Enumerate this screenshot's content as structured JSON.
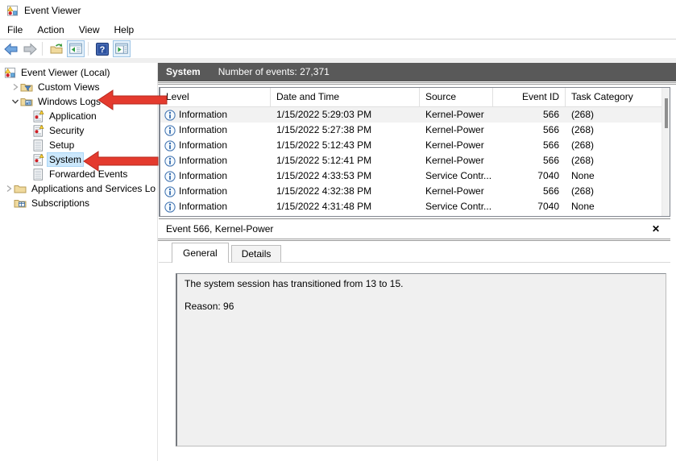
{
  "window": {
    "title": "Event Viewer"
  },
  "menu": {
    "items": [
      "File",
      "Action",
      "View",
      "Help"
    ]
  },
  "toolbar": {
    "buttons": [
      "back",
      "forward",
      "open-saved-log",
      "show-console-tree",
      "help",
      "show-action-pane"
    ]
  },
  "sidebar": {
    "items": [
      {
        "label": "Event Viewer (Local)"
      },
      {
        "label": "Custom Views"
      },
      {
        "label": "Windows Logs"
      },
      {
        "label": "Application"
      },
      {
        "label": "Security"
      },
      {
        "label": "Setup"
      },
      {
        "label": "System"
      },
      {
        "label": "Forwarded Events"
      },
      {
        "label": "Applications and Services Lo"
      },
      {
        "label": "Subscriptions"
      }
    ]
  },
  "main": {
    "header": {
      "log_name": "System",
      "events_count_label": "Number of events: 27,371"
    },
    "table": {
      "columns": [
        "Level",
        "Date and Time",
        "Source",
        "Event ID",
        "Task Category"
      ],
      "rows": [
        {
          "level": "Information",
          "datetime": "1/15/2022 5:29:03 PM",
          "source": "Kernel-Power",
          "event_id": "566",
          "task_category": "(268)"
        },
        {
          "level": "Information",
          "datetime": "1/15/2022 5:27:38 PM",
          "source": "Kernel-Power",
          "event_id": "566",
          "task_category": "(268)"
        },
        {
          "level": "Information",
          "datetime": "1/15/2022 5:12:43 PM",
          "source": "Kernel-Power",
          "event_id": "566",
          "task_category": "(268)"
        },
        {
          "level": "Information",
          "datetime": "1/15/2022 5:12:41 PM",
          "source": "Kernel-Power",
          "event_id": "566",
          "task_category": "(268)"
        },
        {
          "level": "Information",
          "datetime": "1/15/2022 4:33:53 PM",
          "source": "Service Contr...",
          "event_id": "7040",
          "task_category": "None"
        },
        {
          "level": "Information",
          "datetime": "1/15/2022 4:32:38 PM",
          "source": "Kernel-Power",
          "event_id": "566",
          "task_category": "(268)"
        },
        {
          "level": "Information",
          "datetime": "1/15/2022 4:31:48 PM",
          "source": "Service Contr...",
          "event_id": "7040",
          "task_category": "None"
        }
      ]
    },
    "preview": {
      "title": "Event 566, Kernel-Power",
      "close_label": "✕",
      "tabs": [
        "General",
        "Details"
      ],
      "description": "The system session has transitioned from 13 to 15.",
      "reason": "Reason: 96"
    }
  },
  "annotations": {
    "arrows": [
      {
        "points_to": "Windows Logs"
      },
      {
        "points_to": "System"
      }
    ]
  },
  "colors": {
    "arrow_red": "#e43a2e",
    "header_bar": "#595959",
    "tree_selection": "#cce8fc"
  }
}
